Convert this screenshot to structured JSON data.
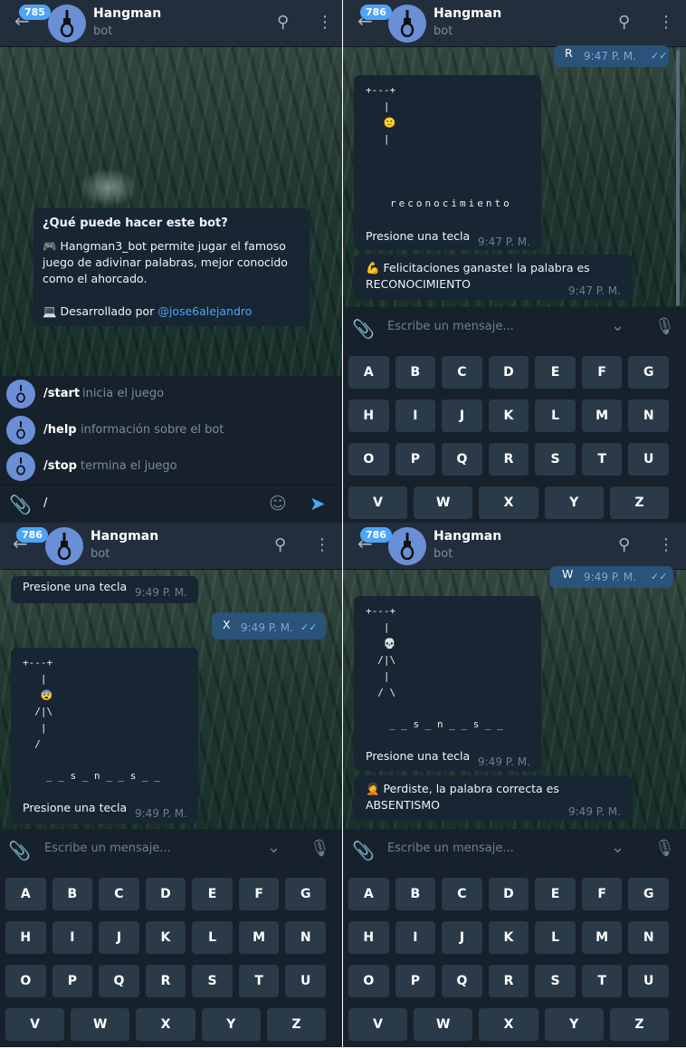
{
  "colors": {
    "accent": "#4ea4f6",
    "bubble": "#182533",
    "outgoing": "#2b5278",
    "header": "#232e3c",
    "key": "#2b3a48"
  },
  "p1": {
    "badge": "785",
    "title": "Hangman",
    "subtitle": "bot",
    "info": {
      "heading": "¿Qué puede hacer este bot?",
      "line1": "🎮 Hangman3_bot permite jugar el famoso",
      "line2": "juego de adivinar palabras, mejor conocido",
      "line3": "como el ahorcado.",
      "dev_prefix": "💻 Desarrollado por",
      "dev_link": "@jose6alejandro"
    },
    "commands": [
      {
        "cmd": "/start",
        "desc": "inicia el juego"
      },
      {
        "cmd": "/help",
        "desc": "información sobre el bot"
      },
      {
        "cmd": "/stop",
        "desc": "termina el juego"
      }
    ],
    "input_value": "/"
  },
  "p2": {
    "badge": "786",
    "title": "Hangman",
    "subtitle": "bot",
    "out_text": "R",
    "out_time": "9:47 P. M.",
    "gallows": "+---+\n   |\n   🙁\n   |",
    "word": "reconocimiento",
    "prompt": "Presione una tecla",
    "prompt_time": "9:47 P. M.",
    "win_line1": "💪 Felicitaciones ganaste! la palabra es",
    "win_line2": "RECONOCIMIENTO",
    "win_time": "9:47 P. M.",
    "placeholder": "Escribe un mensaje..."
  },
  "p3": {
    "badge": "786",
    "title": "Hangman",
    "subtitle": "bot",
    "top_prompt": "Presione una tecla",
    "top_time": "9:49 P. M.",
    "out_text": "X",
    "out_time": "9:49 P. M.",
    "gallows": "+---+\n   |\n   😨\n  /|\\\n   |\n  /",
    "word": "_ _ s _ n _ _ s _ _",
    "prompt": "Presione una tecla",
    "prompt_time": "9:49 P. M.",
    "placeholder": "Escribe un mensaje..."
  },
  "p4": {
    "badge": "786",
    "title": "Hangman",
    "subtitle": "bot",
    "out_text": "W",
    "out_time": "9:49 P. M.",
    "gallows": "+---+\n   |\n   💀\n  /|\\\n   |\n  / \\",
    "word": "_ _ s _ n _ _ s _ _",
    "prompt": "Presione una tecla",
    "prompt_time": "9:49 P. M.",
    "lose_line1": "🤦 Perdiste, la palabra correcta es",
    "lose_line2": "ABSENTISMO",
    "lose_time": "9:49 P. M.",
    "placeholder": "Escribe un mensaje..."
  },
  "keyboard": {
    "row1": [
      "A",
      "B",
      "C",
      "D",
      "E",
      "F",
      "G"
    ],
    "row2": [
      "H",
      "I",
      "J",
      "K",
      "L",
      "M",
      "N"
    ],
    "row3": [
      "O",
      "P",
      "Q",
      "R",
      "S",
      "T",
      "U"
    ],
    "row4": [
      "V",
      "W",
      "X",
      "Y",
      "Z"
    ]
  }
}
